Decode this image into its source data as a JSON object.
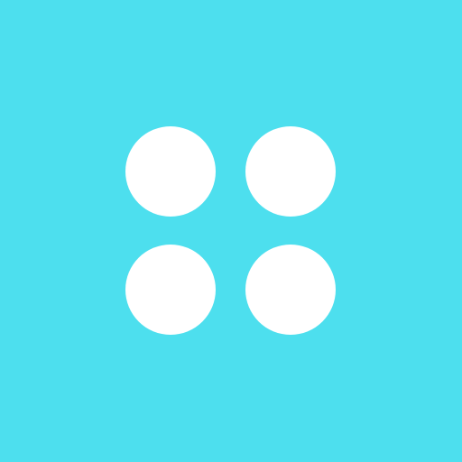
{
  "icon": {
    "name": "four-dots-grid-icon",
    "background_color": "#4ddfee",
    "dot_color": "#ffffff",
    "dot_count": 4
  }
}
